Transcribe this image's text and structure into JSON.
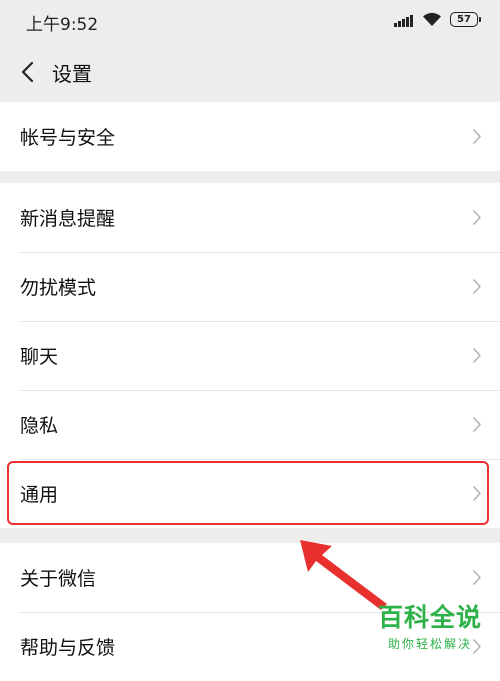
{
  "status_bar": {
    "time": "上午9:52",
    "battery": "57",
    "icons": [
      "signal-icon",
      "wifi-icon",
      "battery-icon"
    ]
  },
  "nav": {
    "title": "设置",
    "back_icon": "chevron-left-icon"
  },
  "settings": {
    "groups": [
      {
        "items": [
          {
            "label": "帐号与安全"
          }
        ]
      },
      {
        "items": [
          {
            "label": "新消息提醒"
          },
          {
            "label": "勿扰模式"
          },
          {
            "label": "聊天"
          },
          {
            "label": "隐私"
          },
          {
            "label": "通用"
          }
        ]
      },
      {
        "items": [
          {
            "label": "关于微信"
          },
          {
            "label": "帮助与反馈"
          }
        ]
      }
    ]
  },
  "annotation": {
    "highlighted_item": "通用",
    "highlight_color": "#e8312f",
    "arrow_icon": "arrow-icon"
  },
  "watermark": {
    "title": "百科全说",
    "subtitle": "助你轻松解决",
    "color": "#2db24a"
  }
}
